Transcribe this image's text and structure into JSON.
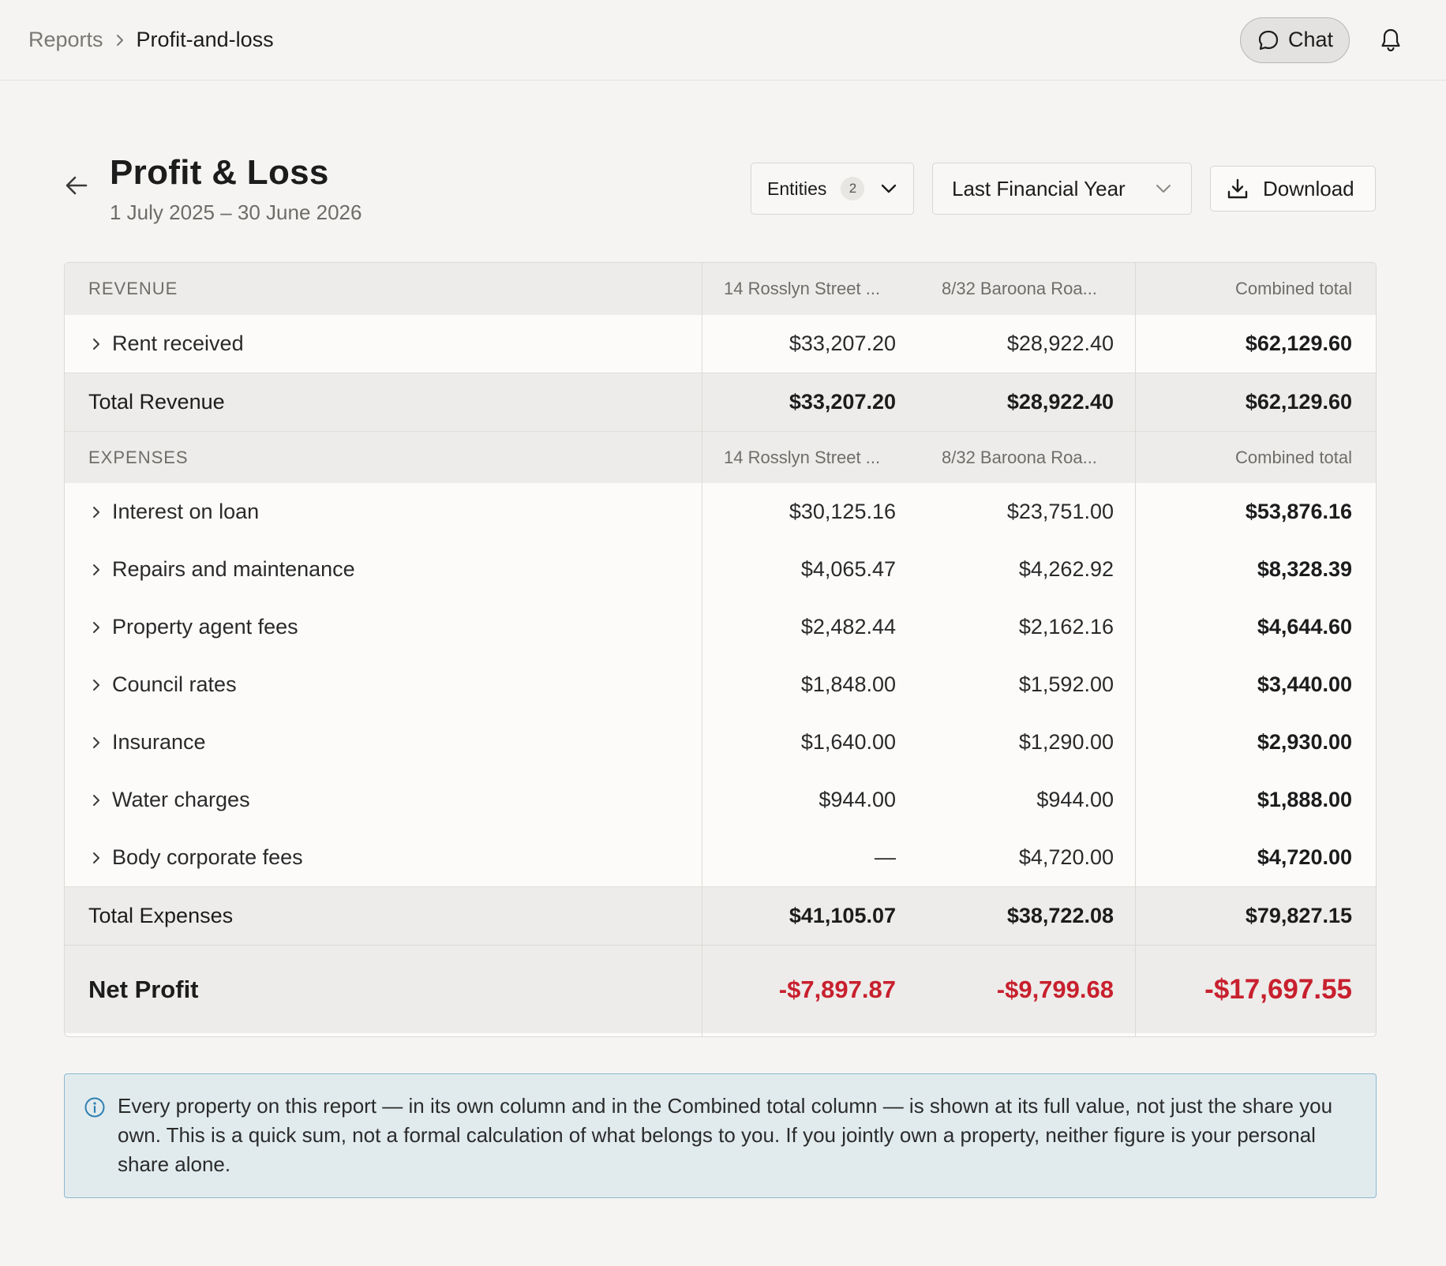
{
  "breadcrumb": {
    "parent": "Reports",
    "current": "Profit-and-loss"
  },
  "topbar": {
    "chat_label": "Chat"
  },
  "header": {
    "title": "Profit & Loss",
    "subtitle": "1 July 2025 – 30 June 2026",
    "entities_label": "Entities",
    "entities_count": "2",
    "period_label": "Last Financial Year",
    "download_label": "Download"
  },
  "columns": {
    "a": "14 Rosslyn Street ...",
    "b": "8/32 Baroona Roa...",
    "total": "Combined total"
  },
  "revenue": {
    "heading": "REVENUE",
    "rows": [
      {
        "label": "Rent received",
        "a": "$33,207.20",
        "b": "$28,922.40",
        "total": "$62,129.60"
      }
    ],
    "total": {
      "label": "Total Revenue",
      "a": "$33,207.20",
      "b": "$28,922.40",
      "total": "$62,129.60"
    }
  },
  "expenses": {
    "heading": "EXPENSES",
    "rows": [
      {
        "label": "Interest on loan",
        "a": "$30,125.16",
        "b": "$23,751.00",
        "total": "$53,876.16"
      },
      {
        "label": "Repairs and maintenance",
        "a": "$4,065.47",
        "b": "$4,262.92",
        "total": "$8,328.39"
      },
      {
        "label": "Property agent fees",
        "a": "$2,482.44",
        "b": "$2,162.16",
        "total": "$4,644.60"
      },
      {
        "label": "Council rates",
        "a": "$1,848.00",
        "b": "$1,592.00",
        "total": "$3,440.00"
      },
      {
        "label": "Insurance",
        "a": "$1,640.00",
        "b": "$1,290.00",
        "total": "$2,930.00"
      },
      {
        "label": "Water charges",
        "a": "$944.00",
        "b": "$944.00",
        "total": "$1,888.00"
      },
      {
        "label": "Body corporate fees",
        "a": "—",
        "b": "$4,720.00",
        "total": "$4,720.00"
      }
    ],
    "total": {
      "label": "Total Expenses",
      "a": "$41,105.07",
      "b": "$38,722.08",
      "total": "$79,827.15"
    }
  },
  "net_profit": {
    "label": "Net Profit",
    "a": "-$7,897.87",
    "b": "-$9,799.68",
    "total": "-$17,697.55"
  },
  "notice": {
    "text": "Every property on this report — in its own column and in the Combined total column — is shown at its full value, not just the share you own. This is a quick sum, not a formal calculation of what belongs to you. If you jointly own a property, neither figure is your personal share alone."
  },
  "colors": {
    "negative": "#c8202e",
    "background": "#f5f4f2",
    "notice_bg": "#e1ebee",
    "notice_border": "#8db8cf"
  },
  "icons": [
    "chevron-right-icon",
    "chat-bubble-icon",
    "bell-icon",
    "arrow-left-icon",
    "chevron-down-icon",
    "download-icon",
    "info-icon"
  ]
}
